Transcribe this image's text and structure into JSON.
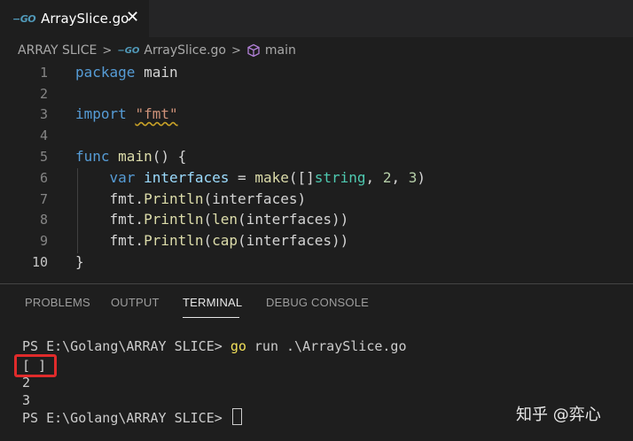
{
  "tab": {
    "icon": "go-file-icon",
    "go_glyph": "−GO",
    "label": "ArraySlice.go",
    "close": "✕"
  },
  "breadcrumb": {
    "folder": "ARRAY SLICE",
    "file": "ArraySlice.go",
    "symbol": "main",
    "sep": ">"
  },
  "editor": {
    "line_numbers": [
      "1",
      "2",
      "3",
      "4",
      "5",
      "6",
      "7",
      "8",
      "9",
      "10"
    ],
    "lines": {
      "l1": [
        "package",
        " main"
      ],
      "l3": [
        "import",
        " ",
        "\"fmt\""
      ],
      "l5": [
        "func",
        " ",
        "main",
        "() {"
      ],
      "l6": [
        "    ",
        "var",
        " ",
        "interfaces",
        " = ",
        "make",
        "([]",
        "string",
        ", ",
        "2",
        ", ",
        "3",
        ")"
      ],
      "l7": [
        "    fmt.",
        "Println",
        "(interfaces)"
      ],
      "l8": [
        "    fmt.",
        "Println",
        "(",
        "len",
        "(interfaces))"
      ],
      "l9": [
        "    fmt.",
        "Println",
        "(",
        "cap",
        "(interfaces))"
      ],
      "l10": [
        "}"
      ]
    }
  },
  "panel": {
    "tabs": [
      "PROBLEMS",
      "OUTPUT",
      "TERMINAL",
      "DEBUG CONSOLE"
    ],
    "active_tab": "TERMINAL"
  },
  "terminal": {
    "prompt1": "PS E:\\Golang\\ARRAY SLICE> ",
    "cmd_go": "go",
    "cmd_rest": " run .\\ArraySlice.go",
    "out1": "[ ]",
    "out2": "2",
    "out3": "3",
    "prompt2": "PS E:\\Golang\\ARRAY SLICE> "
  },
  "watermark": "知乎 @弈心",
  "colors": {
    "keyword": "#569cd6",
    "function": "#dcdcaa",
    "type": "#4ec9b0",
    "string": "#ce9178",
    "number": "#b5cea8",
    "highlight_box": "#e02b2b"
  }
}
